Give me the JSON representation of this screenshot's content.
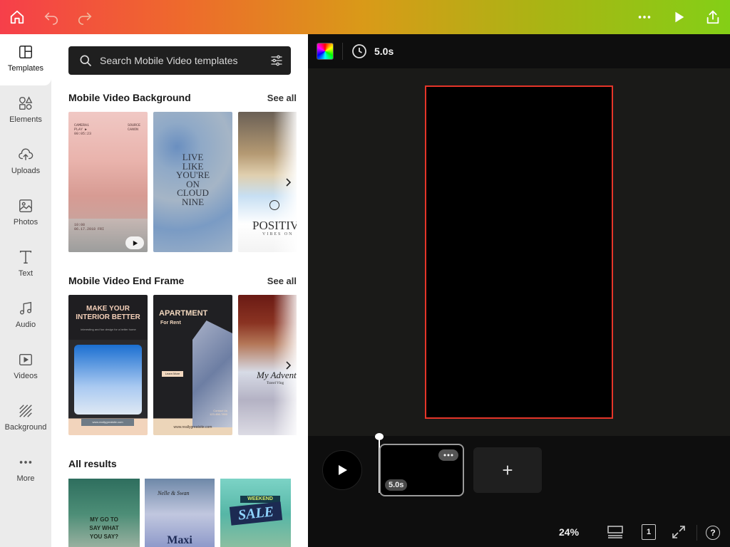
{
  "topbar": {
    "home_icon": "home-icon",
    "undo_icon": "undo-icon",
    "redo_icon": "redo-icon",
    "more_icon": "more-horizontal-icon",
    "play_icon": "play-icon",
    "share_icon": "share-icon"
  },
  "rail": {
    "items": [
      {
        "label": "Templates",
        "icon": "templates-icon"
      },
      {
        "label": "Elements",
        "icon": "elements-icon"
      },
      {
        "label": "Uploads",
        "icon": "uploads-icon"
      },
      {
        "label": "Photos",
        "icon": "photos-icon"
      },
      {
        "label": "Text",
        "icon": "text-icon"
      },
      {
        "label": "Audio",
        "icon": "audio-icon"
      },
      {
        "label": "Videos",
        "icon": "videos-icon"
      },
      {
        "label": "Background",
        "icon": "background-icon"
      },
      {
        "label": "More",
        "icon": "more-icon"
      }
    ]
  },
  "panel": {
    "search": {
      "placeholder": "Search Mobile Video templates"
    },
    "sections": [
      {
        "title": "Mobile Video Background",
        "see_all": "See all"
      },
      {
        "title": "Mobile Video End Frame",
        "see_all": "See all"
      },
      {
        "title": "All results"
      }
    ],
    "bg_templates": [
      {
        "lines_left": "CAMERA1\nPLAY ▶\n00:05:23",
        "lines_right": "SOURCE\nCANON",
        "footer": "10:08\n06.17.2018 FRI"
      },
      {
        "text": "LIVE\nLIKE\nYOU'RE\nON\nCLOUD\nNINE"
      },
      {
        "text": "POSITIV",
        "sub": "VIBES ON"
      }
    ],
    "end_templates": [
      {
        "title": "MAKE YOUR\nINTERIOR BETTER",
        "sub": "interesting and fun design for a better home",
        "footer": "www.reallygreatsite.com"
      },
      {
        "title": "APARTMENT",
        "sub": "For Rent",
        "button": "Learn More",
        "contact": "Contact Us\n123-456-7890",
        "footer": "www.reallygreatsite.com"
      },
      {
        "title": "My Advent",
        "sub": "Travel Vlog"
      }
    ],
    "results": [
      {
        "text": "MY GO TO\nSAY WHAT\nYOU SAY?"
      },
      {
        "text": "Nelle & Swan",
        "sub": "Maxi"
      },
      {
        "text": "WEEKEND",
        "sub": "SALE"
      }
    ]
  },
  "workbar": {
    "duration": "5.0s",
    "color_icon": "color-palette-icon",
    "clock_icon": "clock-icon"
  },
  "timeline": {
    "clip_duration": "5.0s",
    "add_label": "+"
  },
  "bottombar": {
    "zoom": "24%",
    "page_number": "1"
  },
  "colors": {
    "accent_red": "#e53529",
    "canvas_bg": "#000000",
    "stage_bg": "#1a1a18"
  }
}
